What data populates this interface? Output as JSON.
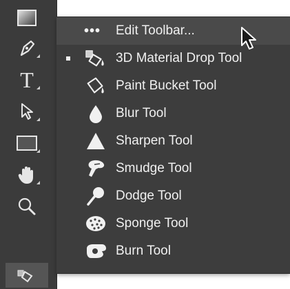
{
  "tools": [
    {
      "name": "gradient-tool"
    },
    {
      "name": "pen-tool"
    },
    {
      "name": "type-tool"
    },
    {
      "name": "path-selection-tool"
    },
    {
      "name": "rectangle-tool"
    },
    {
      "name": "hand-tool"
    },
    {
      "name": "zoom-tool"
    },
    {
      "name": "3d-material-drop-tool"
    }
  ],
  "menu": {
    "edit_toolbar_dots": "•••",
    "edit_toolbar_label": "Edit Toolbar...",
    "items": [
      {
        "label": "3D Material Drop Tool",
        "icon": "3d-material-drop-icon",
        "selected": true
      },
      {
        "label": "Paint Bucket Tool",
        "icon": "paint-bucket-icon"
      },
      {
        "label": "Blur Tool",
        "icon": "blur-drop-icon"
      },
      {
        "label": "Sharpen Tool",
        "icon": "sharpen-triangle-icon"
      },
      {
        "label": "Smudge Tool",
        "icon": "smudge-finger-icon"
      },
      {
        "label": "Dodge Tool",
        "icon": "dodge-lollipop-icon"
      },
      {
        "label": "Sponge Tool",
        "icon": "sponge-icon"
      },
      {
        "label": "Burn Tool",
        "icon": "burn-hand-icon"
      }
    ]
  },
  "colors": {
    "toolbar_bg": "#3b3b3b",
    "menu_bg": "#3d3d3d",
    "hover_bg": "#4a4a4a",
    "text": "#f0f0f0"
  }
}
